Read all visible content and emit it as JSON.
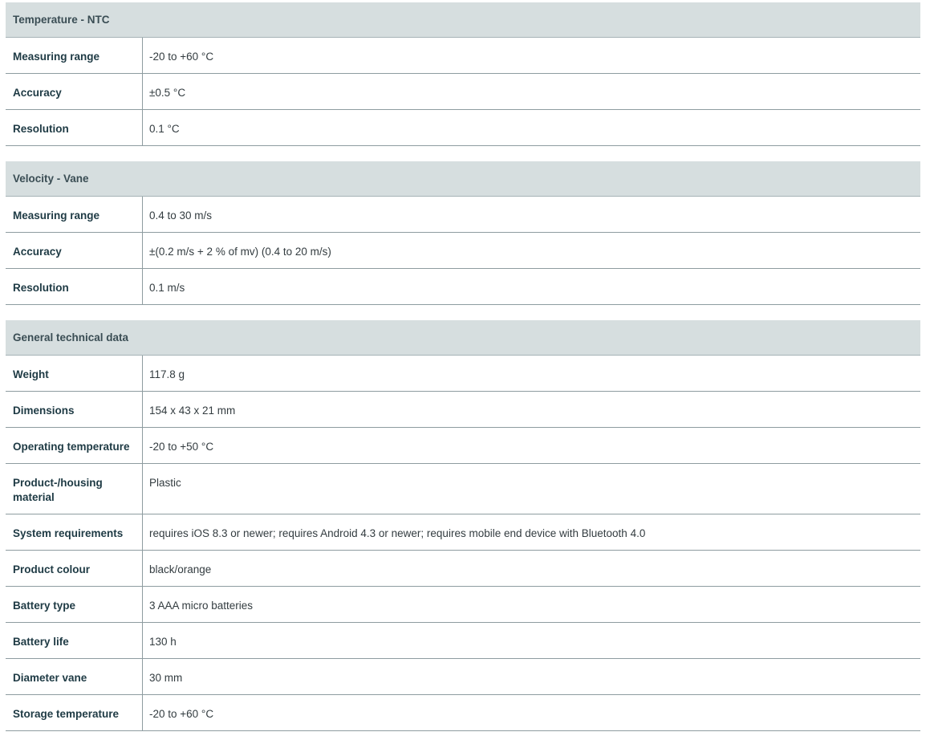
{
  "sections": [
    {
      "title": "Temperature - NTC",
      "rows": [
        {
          "label": "Measuring range",
          "value": "-20 to +60 °C"
        },
        {
          "label": "Accuracy",
          "value": "±0.5 °C"
        },
        {
          "label": "Resolution",
          "value": "0.1 °C"
        }
      ]
    },
    {
      "title": "Velocity - Vane",
      "rows": [
        {
          "label": "Measuring range",
          "value": "0.4 to 30 m/s"
        },
        {
          "label": "Accuracy",
          "value": "±(0.2 m/s + 2 % of mv) (0.4 to 20 m/s)"
        },
        {
          "label": "Resolution",
          "value": "0.1 m/s"
        }
      ]
    },
    {
      "title": "General technical data",
      "rows": [
        {
          "label": "Weight",
          "value": "117.8 g"
        },
        {
          "label": "Dimensions",
          "value": "154 x 43 x 21 mm"
        },
        {
          "label": "Operating temperature",
          "value": "-20 to +50 °C"
        },
        {
          "label": "Product-/housing material",
          "value": "Plastic"
        },
        {
          "label": "System requirements",
          "value": "requires iOS 8.3 or newer; requires Android 4.3 or newer; requires mobile end device with Bluetooth 4.0"
        },
        {
          "label": "Product colour",
          "value": "black/orange"
        },
        {
          "label": "Battery type",
          "value": "3 AAA micro batteries"
        },
        {
          "label": "Battery life",
          "value": "130 h"
        },
        {
          "label": "Diameter vane",
          "value": "30 mm"
        },
        {
          "label": "Storage temperature",
          "value": "-20 to +60 °C"
        }
      ]
    }
  ]
}
